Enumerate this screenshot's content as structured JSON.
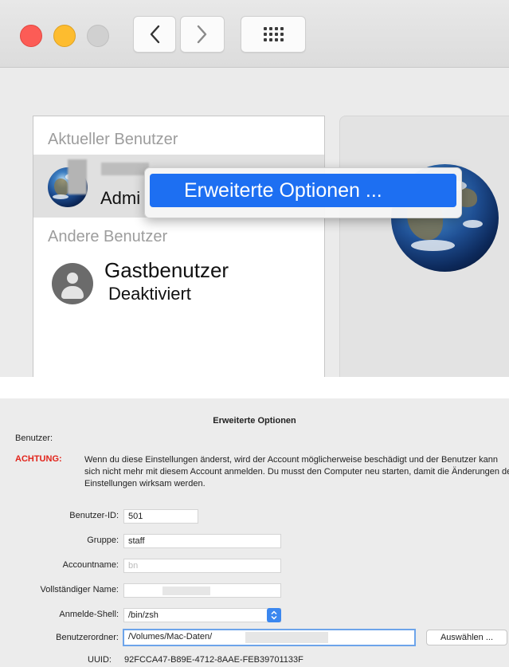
{
  "top_panel": {
    "nav": {
      "back_icon": "chevron-left-icon",
      "forward_icon": "chevron-right-icon",
      "grid_icon": "grid-icon"
    },
    "current_users_label": "Aktueller Benutzer",
    "current_user_role": "Admi",
    "other_users_label": "Andere Benutzer",
    "guest_name": "Gastbenutzer",
    "guest_status": "Deaktiviert",
    "context_menu_item": "Erweiterte Optionen ..."
  },
  "dialog": {
    "title": "Erweiterte Optionen",
    "user_label": "Benutzer:",
    "warning_label": "ACHTUNG:",
    "warning_text": "Wenn du diese Einstellungen änderst, wird der Account möglicherweise beschädigt und der Benutzer kann sich nicht mehr mit diesem Account anmelden. Du musst den Computer neu starten, damit die Änderungen der Einstellungen wirksam werden.",
    "fields": {
      "user_id_label": "Benutzer-ID:",
      "user_id_value": "501",
      "group_label": "Gruppe:",
      "group_value": "staff",
      "account_name_label": "Accountname:",
      "account_name_value": "bn",
      "full_name_label": "Vollständiger Name:",
      "login_shell_label": "Anmelde-Shell:",
      "login_shell_value": "/bin/zsh",
      "home_folder_label": "Benutzerordner:",
      "home_folder_value": "/Volumes/Mac-Daten/",
      "choose_button": "Auswählen ...",
      "uuid_label": "UUID:",
      "uuid_value": "92FCCA47-B89E-4712-8AAE-FEB39701133F"
    },
    "colors": {
      "warning": "#e2231a",
      "accent": "#1d6ff2"
    }
  }
}
